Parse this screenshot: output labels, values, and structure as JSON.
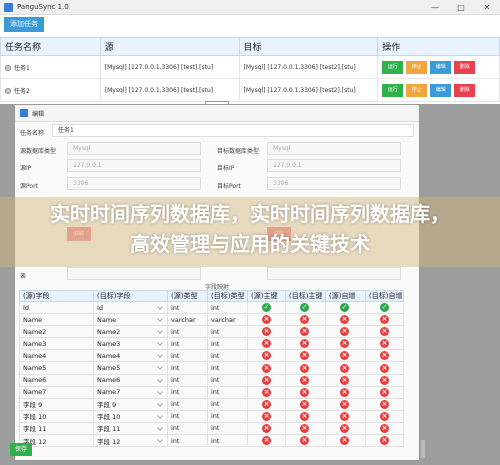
{
  "app": {
    "title": "PanguSync 1.0"
  },
  "toolbar": {
    "add_label": "添加任务"
  },
  "tasks": {
    "headers": [
      "任务名称",
      "源",
      "目标",
      "操作"
    ],
    "rows": [
      {
        "name": "任务1",
        "source": "[Mysql] [127.0.0.1,3306] [test].[stu]",
        "target": "[Mysql] [127.0.0.1,3306] [test2].[stu]"
      },
      {
        "name": "任务2",
        "source": "[Mysql] [127.0.0.1,3306] [test].[stu]",
        "target": "[Mysql] [127.0.0.1,3306] [test2].[stu]"
      }
    ],
    "actions": [
      "运行",
      "停止",
      "编辑",
      "删除"
    ]
  },
  "dialog": {
    "title": "编辑",
    "task_name_label": "任务名称",
    "task_name_value": "任务1",
    "src_type_label": "源数据库类型",
    "src_type_value": "Mysql",
    "dst_type_label": "目标数据库类型",
    "dst_type_value": "Mysql",
    "src_ip_label": "源IP",
    "src_ip_value": "127.0.0.1",
    "dst_ip_label": "目标IP",
    "dst_ip_value": "127.0.0.1",
    "src_port_label": "源Port",
    "src_port_value": "3306",
    "dst_port_label": "目标Port",
    "dst_port_value": "3306",
    "src_btn": "获取",
    "dst_btn": "获取",
    "table_label": "表",
    "mapping_title": "字段映射",
    "save_label": "保存"
  },
  "mapping": {
    "headers": [
      "(源)字段",
      "(目标)字段",
      "(源)类型",
      "(目标)类型",
      "(源)主键",
      "(目标)主键",
      "(源)自增",
      "(目标)自增"
    ],
    "rows": [
      {
        "src": "Id",
        "dst": "Id",
        "st": "int",
        "dt": "int",
        "flags": [
          1,
          1,
          1,
          1
        ]
      },
      {
        "src": "Name",
        "dst": "Name",
        "st": "varchar",
        "dt": "varchar",
        "flags": [
          0,
          0,
          0,
          0
        ]
      },
      {
        "src": "Name2",
        "dst": "Name2",
        "st": "int",
        "dt": "int",
        "flags": [
          0,
          0,
          0,
          0
        ]
      },
      {
        "src": "Name3",
        "dst": "Name3",
        "st": "int",
        "dt": "int",
        "flags": [
          0,
          0,
          0,
          0
        ]
      },
      {
        "src": "Name4",
        "dst": "Name4",
        "st": "int",
        "dt": "int",
        "flags": [
          0,
          0,
          0,
          0
        ]
      },
      {
        "src": "Name5",
        "dst": "Name5",
        "st": "int",
        "dt": "int",
        "flags": [
          0,
          0,
          0,
          0
        ]
      },
      {
        "src": "Name6",
        "dst": "Name6",
        "st": "int",
        "dt": "int",
        "flags": [
          0,
          0,
          0,
          0
        ]
      },
      {
        "src": "Name7",
        "dst": "Name7",
        "st": "int",
        "dt": "int",
        "flags": [
          0,
          0,
          0,
          0
        ]
      },
      {
        "src": "字段 9",
        "dst": "字段 9",
        "st": "int",
        "dt": "int",
        "flags": [
          0,
          0,
          0,
          0
        ]
      },
      {
        "src": "字段 10",
        "dst": "字段 10",
        "st": "int",
        "dt": "int",
        "flags": [
          0,
          0,
          0,
          0
        ]
      },
      {
        "src": "字段 11",
        "dst": "字段 11",
        "st": "int",
        "dt": "int",
        "flags": [
          0,
          0,
          0,
          0
        ]
      },
      {
        "src": "字段 12",
        "dst": "字段 12",
        "st": "int",
        "dt": "int",
        "flags": [
          0,
          0,
          0,
          0
        ]
      }
    ]
  },
  "banner": {
    "text": "实时时间序列数据库，实时时间序列数据库，高效管理与应用的关键技术"
  }
}
